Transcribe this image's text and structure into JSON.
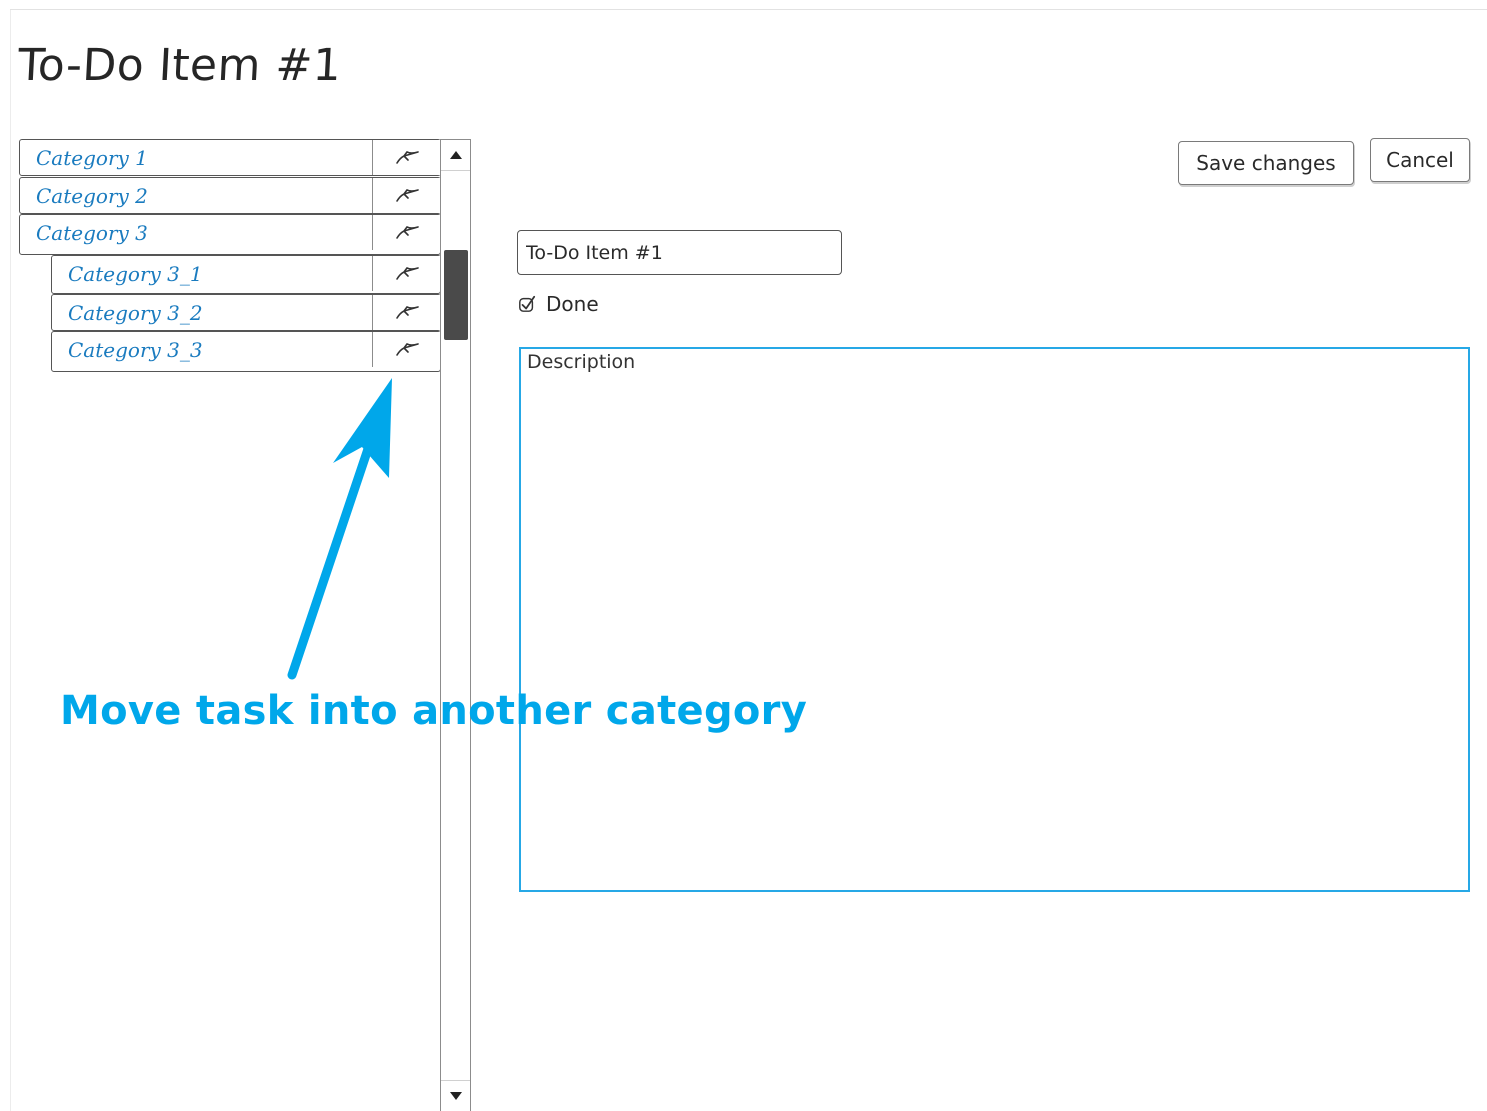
{
  "page": {
    "title": "To-Do Item #1"
  },
  "categories": [
    {
      "label": "Category 1",
      "level": 0
    },
    {
      "label": "Category 2",
      "level": 0
    },
    {
      "label": "Category 3",
      "level": 0
    },
    {
      "label": "Category 3_1",
      "level": 1
    },
    {
      "label": "Category 3_2",
      "level": 1
    },
    {
      "label": "Category 3_3",
      "level": 1
    }
  ],
  "actions": {
    "save_label": "Save changes",
    "cancel_label": "Cancel"
  },
  "form": {
    "title_value": "To-Do Item #1",
    "done_label": "Done",
    "done_checked": true,
    "description_placeholder": "Description"
  },
  "annotation": {
    "text": "Move task into another category",
    "color": "#00a7ea"
  },
  "icons": {
    "move": "move-arrow-icon",
    "scroll_up": "triangle-up-icon",
    "scroll_down": "triangle-down-icon",
    "check": "checkmark-icon"
  }
}
